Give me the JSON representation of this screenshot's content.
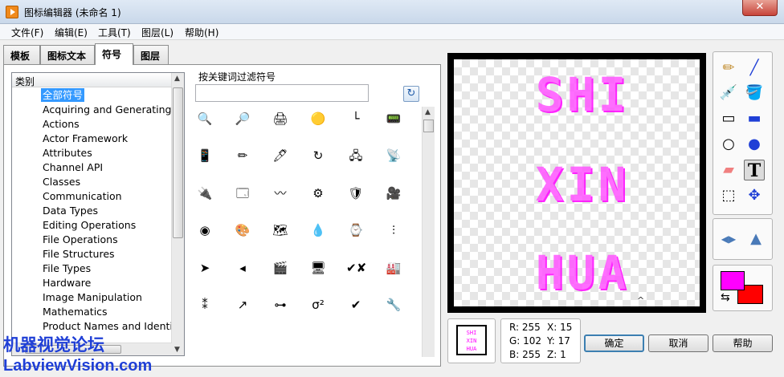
{
  "window": {
    "title": "图标编辑器 (未命名 1)",
    "close_glyph": "✕"
  },
  "menu": [
    "文件(F)",
    "编辑(E)",
    "工具(T)",
    "图层(L)",
    "帮助(H)"
  ],
  "tabs": [
    {
      "label": "模板",
      "active": false
    },
    {
      "label": "图标文本",
      "active": false
    },
    {
      "label": "符号",
      "active": true
    },
    {
      "label": "图层",
      "active": false
    }
  ],
  "category": {
    "header": "类别",
    "items": [
      "全部符号",
      "Acquiring and Generating D",
      "Actions",
      "Actor Framework",
      "Attributes",
      "Channel API",
      "Classes",
      "Communication",
      "Data Types",
      "Editing Operations",
      "File Operations",
      "File Structures",
      "File Types",
      "Hardware",
      "Image Manipulation",
      "Mathematics",
      "Product Names and Identif"
    ],
    "selected_index": 0
  },
  "filter": {
    "label": "按关键词过滤符号",
    "value": "",
    "placeholder": ""
  },
  "symbols": [
    [
      "🔍",
      "🔎",
      "🖨",
      "🟡",
      "└",
      "📟"
    ],
    [
      "📱",
      "✏",
      "🖊",
      "↻",
      "🖧",
      "📡"
    ],
    [
      "🔌",
      "🗔",
      "〰",
      "⚙",
      "🛡",
      "🎥"
    ],
    [
      "◉",
      "🎨",
      "🗺",
      "💧",
      "⌚",
      "⫶"
    ],
    [
      "➤",
      "◂",
      "🎬",
      "🖥",
      "✔✘",
      "🏭"
    ],
    [
      "⁑",
      "↗",
      "⊶",
      "σ²",
      "✔",
      "🔧"
    ]
  ],
  "canvas_text": [
    "SHI",
    "XIN",
    "HUA"
  ],
  "canvas_caret": "^",
  "tools": [
    {
      "name": "pencil-tool",
      "glyph": "✏",
      "color": "#c08a2a"
    },
    {
      "name": "line-tool",
      "glyph": "╱",
      "color": "#1f3fd6"
    },
    {
      "name": "dropper-tool",
      "glyph": "💉",
      "color": "#1f3fd6"
    },
    {
      "name": "fill-tool",
      "glyph": "🪣",
      "color": "#333333"
    },
    {
      "name": "rectangle-tool",
      "glyph": "▭",
      "color": "#000000"
    },
    {
      "name": "filled-rectangle-tool",
      "glyph": "▬",
      "color": "#1f3fd6"
    },
    {
      "name": "ellipse-tool",
      "glyph": "○",
      "color": "#000000"
    },
    {
      "name": "filled-ellipse-tool",
      "glyph": "●",
      "color": "#1f3fd6"
    },
    {
      "name": "eraser-tool",
      "glyph": "▰",
      "color": "#f08080"
    },
    {
      "name": "text-tool",
      "glyph": "T",
      "color": "#000000",
      "active": true
    },
    {
      "name": "select-tool",
      "glyph": "⬚",
      "color": "#000000"
    },
    {
      "name": "move-tool",
      "glyph": "✥",
      "color": "#1f3fd6"
    }
  ],
  "flip_tools": [
    {
      "name": "flip-horizontal-tool",
      "glyph": "◀▶"
    },
    {
      "name": "flip-vertical-tool",
      "glyph": "▲"
    }
  ],
  "colors": {
    "foreground": "#ff00ff",
    "background": "#ff0000",
    "swap_glyph": "⇆"
  },
  "preview_text": [
    "SHI",
    "XIN",
    "HUA"
  ],
  "readout": {
    "r": "R: 255",
    "g": "G: 102",
    "b": "B: 255",
    "x": "X: 15",
    "y": "Y: 17",
    "z": "Z: 1"
  },
  "buttons": {
    "ok": "确定",
    "cancel": "取消",
    "help": "帮助"
  },
  "watermark": {
    "line1": "机器视觉论坛",
    "line2": "LabviewVision.com"
  }
}
